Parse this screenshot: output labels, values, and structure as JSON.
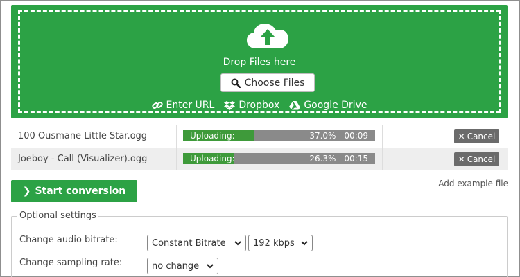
{
  "upload": {
    "drop_text": "Drop Files here",
    "choose_label": "Choose Files",
    "sources": [
      {
        "label": "Enter URL",
        "icon": "link-icon"
      },
      {
        "label": "Dropbox",
        "icon": "dropbox-icon"
      },
      {
        "label": "Google Drive",
        "icon": "google-drive-icon"
      }
    ],
    "icon": "cloud-upload-icon"
  },
  "files": [
    {
      "name": "100 Ousmane Little Star.ogg",
      "status": "Uploading:",
      "progress": 37.0,
      "progress_text": "37.0% - 00:09",
      "cancel_label": "Cancel"
    },
    {
      "name": "Joeboy - Call (Visualizer).ogg",
      "status": "Uploading:",
      "progress": 26.3,
      "progress_text": "26.3% - 00:15",
      "cancel_label": "Cancel"
    }
  ],
  "actions": {
    "start_label": "Start conversion",
    "example_label": "Add example file"
  },
  "settings": {
    "legend": "Optional settings",
    "bitrate_label": "Change audio bitrate:",
    "bitrate_mode": "Constant Bitrate",
    "bitrate_value": "192 kbps",
    "sampling_label": "Change sampling rate:",
    "sampling_value": "no change"
  },
  "colors": {
    "accent": "#2ca245",
    "progress_fill": "#3e9a3a",
    "progress_track": "#8a8a8a",
    "cancel": "#6b6b6b"
  }
}
